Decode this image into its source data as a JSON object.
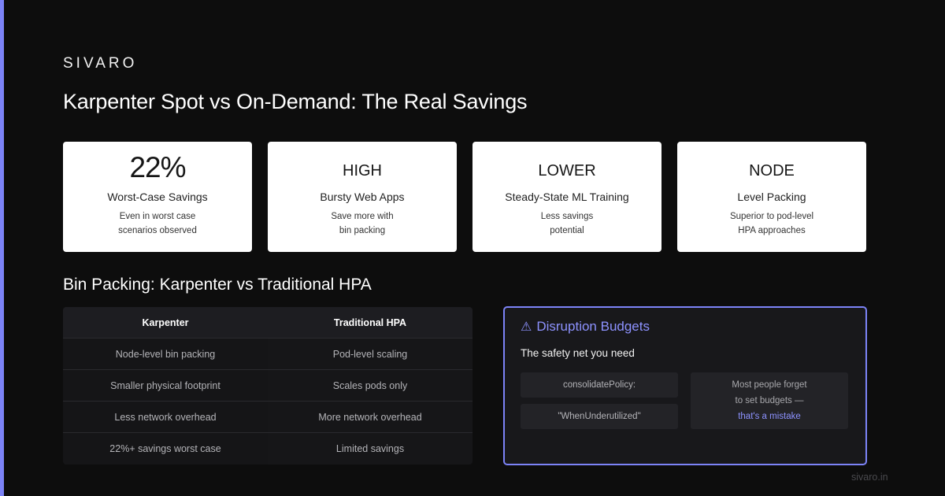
{
  "brand": "SIVARO",
  "title": "Karpenter Spot vs On-Demand: The Real Savings",
  "colors": {
    "accent": "#7c83f7",
    "background": "#0d0d0d",
    "card": "#ffffff"
  },
  "cards": [
    {
      "value": "22%",
      "label": "Worst-Case Savings",
      "desc_line1": "Even in worst case",
      "desc_line2": "scenarios observed"
    },
    {
      "value": "HIGH",
      "label": "Bursty Web Apps",
      "desc_line1": "Save more with",
      "desc_line2": "bin packing"
    },
    {
      "value": "LOWER",
      "label": "Steady-State ML Training",
      "desc_line1": "Less savings",
      "desc_line2": "potential"
    },
    {
      "value": "NODE",
      "label": "Level Packing",
      "desc_line1": "Superior to pod-level",
      "desc_line2": "HPA approaches"
    }
  ],
  "comparison": {
    "title": "Bin Packing: Karpenter vs Traditional HPA",
    "headers": [
      "Karpenter",
      "Traditional HPA"
    ],
    "rows": [
      [
        "Node-level bin packing",
        "Pod-level scaling"
      ],
      [
        "Smaller physical footprint",
        "Scales pods only"
      ],
      [
        "Less network overhead",
        "More network overhead"
      ],
      [
        "22%+ savings worst case",
        "Limited savings"
      ]
    ]
  },
  "panel": {
    "icon": "warning-icon",
    "icon_glyph": "⚠",
    "title": "Disruption Budgets",
    "subtitle": "The safety net you need",
    "code_line1": "consolidatePolicy:",
    "code_line2": "\"WhenUnderutilized\"",
    "note_line1": "Most people forget",
    "note_line2": "to set budgets —",
    "note_highlight": "that's a mistake"
  },
  "footer": "sivaro.in"
}
